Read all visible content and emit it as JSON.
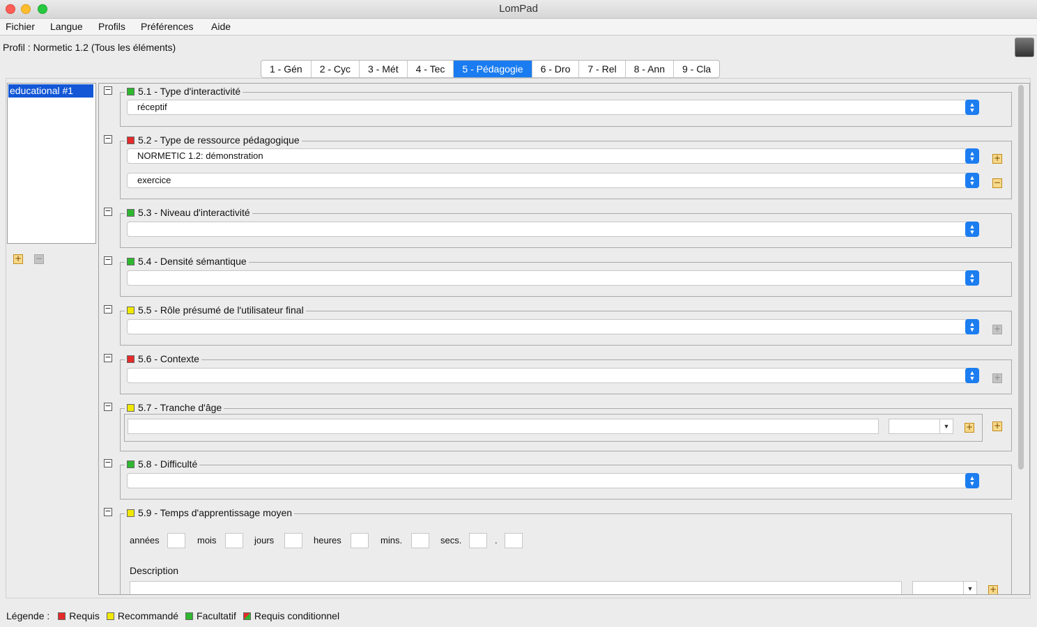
{
  "window": {
    "title": "LomPad"
  },
  "menu": [
    "Fichier",
    "Langue",
    "Profils",
    "Préférences",
    "Aide"
  ],
  "profile": {
    "text": "Profil : Normetic 1.2 (Tous les éléments)"
  },
  "tabs": [
    "1 - Gén",
    "2 - Cyc",
    "3 - Mét",
    "4 - Tec",
    "5 - Pédagogie",
    "6 - Dro",
    "7 - Rel",
    "8 - Ann",
    "9 - Cla"
  ],
  "active_tab": "5 - Pédagogie",
  "left_list": {
    "selected": "educational #1"
  },
  "sections": {
    "s51": {
      "title": "5.1 - Type d'interactivité",
      "status": "facultatif",
      "value": "réceptif"
    },
    "s52": {
      "title": "5.2 - Type de ressource pédagogique",
      "status": "requis",
      "values": [
        "NORMETIC 1.2: démonstration",
        "exercice"
      ]
    },
    "s53": {
      "title": "5.3 - Niveau d'interactivité",
      "status": "facultatif",
      "value": ""
    },
    "s54": {
      "title": "5.4 - Densité sémantique",
      "status": "facultatif",
      "value": ""
    },
    "s55": {
      "title": "5.5 - Rôle présumé de l'utilisateur final",
      "status": "recommandé",
      "value": ""
    },
    "s56": {
      "title": "5.6 - Contexte",
      "status": "requis",
      "value": ""
    },
    "s57": {
      "title": "5.7 - Tranche d'âge",
      "status": "recommandé",
      "value": ""
    },
    "s58": {
      "title": "5.8 - Difficulté",
      "status": "facultatif",
      "value": ""
    },
    "s59": {
      "title": "5.9 - Temps d'apprentissage moyen",
      "status": "recommandé",
      "duration_labels": {
        "years": "années",
        "months": "mois",
        "days": "jours",
        "hours": "heures",
        "mins": "mins.",
        "secs": "secs.",
        "dot": "."
      },
      "description_label": "Description"
    }
  },
  "footer": {
    "label": "Légende :",
    "requis": "Requis",
    "recommande": "Recommandé",
    "facultatif": "Facultatif",
    "conditionnel": "Requis conditionnel"
  },
  "colors": {
    "requis": "#e42a2a",
    "recommande": "#f0e800",
    "facultatif": "#2fb72f",
    "accent": "#1a7cf0"
  }
}
